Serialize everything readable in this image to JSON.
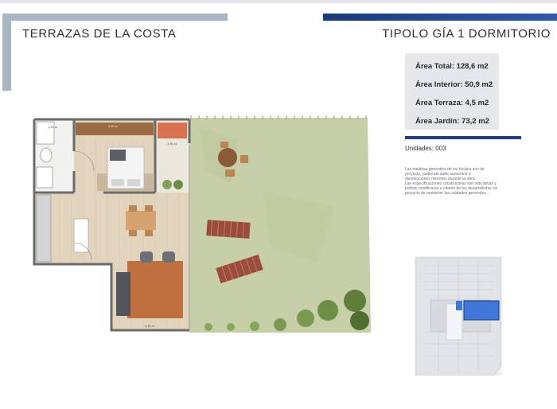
{
  "header": {
    "project_name": "TERRAZAS DE LA COSTA",
    "unit_type": "TIPOLO GÍA 1 DORMITORIO"
  },
  "areas": [
    {
      "label": "Área Total:",
      "value": "128,6 m2"
    },
    {
      "label": "Área Interior:",
      "value": "50,9 m2"
    },
    {
      "label": "Área Terraza:",
      "value": "4,5 m2"
    },
    {
      "label": "Área Jardín:",
      "value": "73,2 m2"
    }
  ],
  "units_text": "Unidades: 003",
  "disclaimer": [
    "Las medidas generales de los locales son de",
    "proyecto, pudiendo sufrir aumentos o",
    "disminuciones menores durante la obra.",
    "Las especificaciones constructivas son indicativas y",
    "podrán modificarse a criterio de los desarrollistas sin",
    "perjuicio de mantener las calidades generales."
  ],
  "plan": {
    "dim_bath": "1,50 m",
    "dim_bed": "3,60 m",
    "dim_terrace": "1,50 m",
    "dim_living": "3,30 m"
  },
  "colors": {
    "accent_blue": "#1b3a78",
    "bracket_grey": "#a8b5c2",
    "garden_green": "#c6cfa8",
    "floor_wood": "#e3d4bd",
    "highlight_unit": "#3f78d8"
  }
}
